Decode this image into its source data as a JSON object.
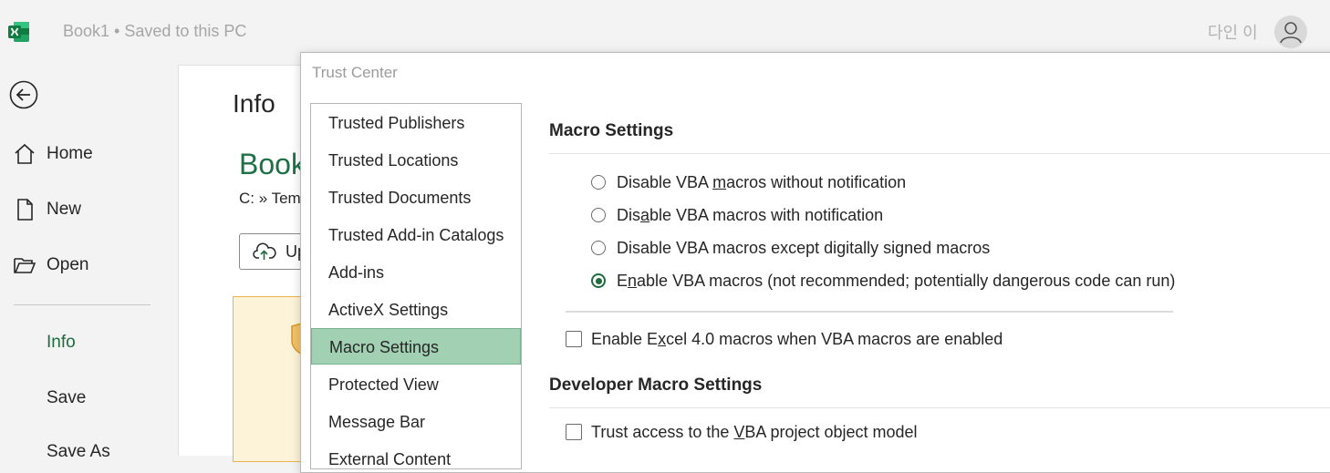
{
  "app": {
    "document_title": "Book1 • Saved to this PC",
    "user_name": "다인 이",
    "accent_color": "#1e6b3c"
  },
  "nav": {
    "items": [
      {
        "label": "Home",
        "icon": "home-icon"
      },
      {
        "label": "New",
        "icon": "new-document-icon"
      },
      {
        "label": "Open",
        "icon": "folder-open-icon"
      },
      {
        "label": "Info"
      },
      {
        "label": "Save"
      },
      {
        "label": "Save As"
      }
    ]
  },
  "info": {
    "title": "Info",
    "book_name": "Book",
    "path": "C: » Tem",
    "upload_label": "Up"
  },
  "dialog": {
    "title": "Trust Center",
    "categories": [
      "Trusted Publishers",
      "Trusted Locations",
      "Trusted Documents",
      "Trusted Add-in Catalogs",
      "Add-ins",
      "ActiveX Settings",
      "Macro Settings",
      "Protected View",
      "Message Bar",
      "External Content"
    ],
    "selected_category": "Macro Settings",
    "macro_section_title": "Macro Settings",
    "macro_options": [
      {
        "pre": "Disable VBA ",
        "key": "m",
        "post": "acros without notification",
        "checked": false
      },
      {
        "pre": "Dis",
        "key": "a",
        "post": "ble VBA macros with notification",
        "checked": false
      },
      {
        "pre": "Disable VBA macros except di",
        "key": "g",
        "post": "itally signed macros",
        "checked": false
      },
      {
        "pre": "E",
        "key": "n",
        "post": "able VBA macros (not recommended; potentially dangerous code can run)",
        "checked": true
      }
    ],
    "excel4_option": {
      "pre": "Enable E",
      "key": "x",
      "post": "cel 4.0 macros when VBA macros are enabled",
      "checked": false
    },
    "developer_section_title": "Developer Macro Settings",
    "vba_trust_option": {
      "pre": "Trust access to the ",
      "key": "V",
      "post": "BA project object model",
      "checked": false
    }
  }
}
